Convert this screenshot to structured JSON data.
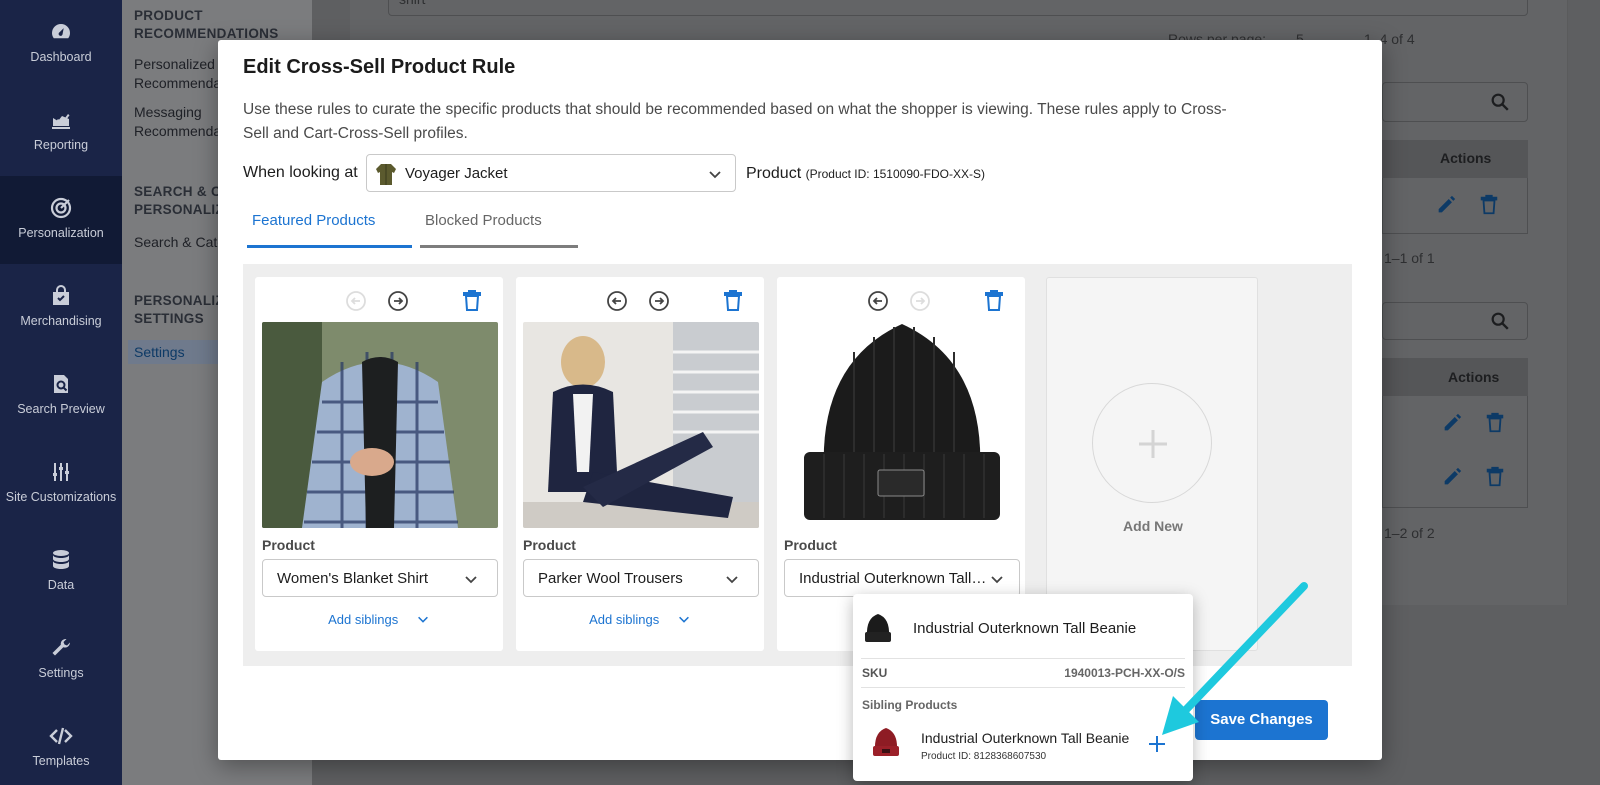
{
  "sidebar": {
    "items": [
      {
        "label": "Dashboard",
        "icon": "dashboard-icon"
      },
      {
        "label": "Reporting",
        "icon": "chart-icon"
      },
      {
        "label": "Personalization",
        "icon": "target-icon",
        "active": true
      },
      {
        "label": "Merchandising",
        "icon": "bag-icon"
      },
      {
        "label": "Search Preview",
        "icon": "search-doc-icon"
      },
      {
        "label": "Site Customizations",
        "icon": "sliders-icon"
      },
      {
        "label": "Data",
        "icon": "database-icon"
      },
      {
        "label": "Settings",
        "icon": "wrench-icon"
      },
      {
        "label": "Templates",
        "icon": "code-icon"
      }
    ]
  },
  "subpanel": {
    "section1": "PRODUCT RECOMMENDATIONS",
    "link1": "Personalized Recommendations",
    "link2": "Messaging Recommendations",
    "section2": "SEARCH & CATEGORY PERSONALIZATION",
    "link3": "Search & Category",
    "section3": "PERSONALIZATION SETTINGS",
    "link4": "Settings"
  },
  "background": {
    "field_value": "shirt",
    "rows_per_page_label": "Rows per page:",
    "rows_per_page_value": "5",
    "pagination1": "1–4 of 4",
    "actions_header": "Actions",
    "pagination2": "1–1 of 1",
    "pagination3": "1–2 of 2"
  },
  "modal": {
    "title": "Edit Cross-Sell Product Rule",
    "description": "Use these rules to curate the specific products that should be recommended based on what the shopper is viewing. These rules apply to Cross-Sell and Cart-Cross-Sell profiles.",
    "when_label": "When looking at",
    "when_value": "Voyager Jacket",
    "when_type": "Product",
    "when_product_id": "(Product ID: 1510090-FDO-XX-S)",
    "tabs": [
      "Featured Products",
      "Blocked Products"
    ],
    "product_label": "Product",
    "add_siblings": "Add siblings",
    "cards": [
      {
        "product": "Women's Blanket Shirt"
      },
      {
        "product": "Parker Wool Trousers"
      },
      {
        "product": "Industrial Outerknown Tall Beanie"
      }
    ],
    "add_new": "Add New",
    "save_button": "Save Changes"
  },
  "dropdown": {
    "option_name": "Industrial Outerknown Tall Beanie",
    "sku_label": "SKU",
    "sku_value": "1940013-PCH-XX-O/S",
    "sibling_header": "Sibling Products",
    "sibling_name": "Industrial Outerknown Tall Beanie",
    "sibling_id": "Product ID: 8128368607530"
  },
  "colors": {
    "accent": "#1c74d1",
    "annotation_arrow": "#1ec9de",
    "sidebar_bg": "#1a2447"
  }
}
